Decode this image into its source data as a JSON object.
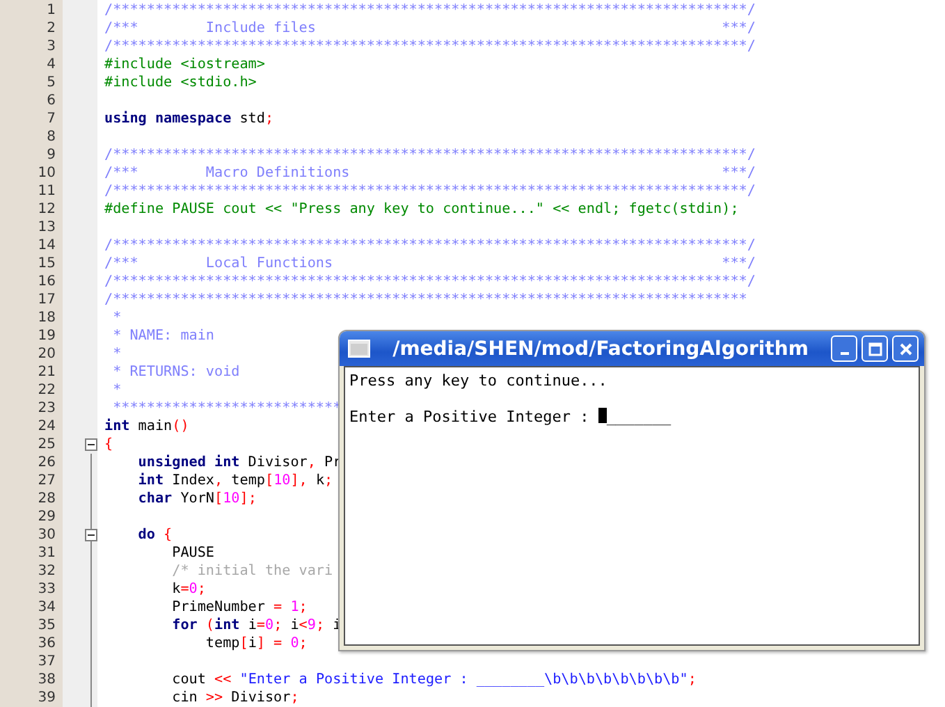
{
  "editor": {
    "lines": [
      {
        "number": "1",
        "tokens": [
          {
            "kind": "doc",
            "text": "/***************************************************************************/"
          }
        ]
      },
      {
        "number": "2",
        "tokens": [
          {
            "kind": "doc",
            "text": "/***        Include files                                                ***/"
          }
        ]
      },
      {
        "number": "3",
        "tokens": [
          {
            "kind": "doc",
            "text": "/***************************************************************************/"
          }
        ]
      },
      {
        "number": "4",
        "tokens": [
          {
            "kind": "preproc",
            "text": "#include <iostream>"
          }
        ]
      },
      {
        "number": "5",
        "tokens": [
          {
            "kind": "preproc",
            "text": "#include <stdio.h>"
          }
        ]
      },
      {
        "number": "6"
      },
      {
        "number": "7",
        "tokens": [
          {
            "kind": "keyword",
            "text": "using namespace"
          },
          {
            "kind": "plain",
            "text": " std"
          },
          {
            "kind": "operator",
            "text": ";"
          }
        ]
      },
      {
        "number": "8"
      },
      {
        "number": "9",
        "tokens": [
          {
            "kind": "doc",
            "text": "/***************************************************************************/"
          }
        ]
      },
      {
        "number": "10",
        "tokens": [
          {
            "kind": "doc",
            "text": "/***        Macro Definitions                                            ***/"
          }
        ]
      },
      {
        "number": "11",
        "tokens": [
          {
            "kind": "doc",
            "text": "/***************************************************************************/"
          }
        ]
      },
      {
        "number": "12",
        "tokens": [
          {
            "kind": "preproc",
            "text": "#define PAUSE cout << \"Press any key to continue...\" << endl; fgetc(stdin);"
          }
        ]
      },
      {
        "number": "13"
      },
      {
        "number": "14",
        "tokens": [
          {
            "kind": "doc",
            "text": "/***************************************************************************/"
          }
        ]
      },
      {
        "number": "15",
        "tokens": [
          {
            "kind": "doc",
            "text": "/***        Local Functions                                              ***/"
          }
        ]
      },
      {
        "number": "16",
        "tokens": [
          {
            "kind": "doc",
            "text": "/***************************************************************************/"
          }
        ]
      },
      {
        "number": "17",
        "tokens": [
          {
            "kind": "doc",
            "text": "/***************************************************************************"
          }
        ]
      },
      {
        "number": "18",
        "tokens": [
          {
            "kind": "doc",
            "text": " *"
          }
        ]
      },
      {
        "number": "19",
        "tokens": [
          {
            "kind": "doc",
            "text": " * NAME: main"
          }
        ]
      },
      {
        "number": "20",
        "tokens": [
          {
            "kind": "doc",
            "text": " *"
          }
        ]
      },
      {
        "number": "21",
        "tokens": [
          {
            "kind": "doc",
            "text": " * RETURNS: void"
          }
        ]
      },
      {
        "number": "22",
        "tokens": [
          {
            "kind": "doc",
            "text": " *"
          }
        ]
      },
      {
        "number": "23",
        "tokens": [
          {
            "kind": "doc",
            "text": " ***************************"
          }
        ]
      },
      {
        "number": "24",
        "tokens": [
          {
            "kind": "keyword",
            "text": "int"
          },
          {
            "kind": "plain",
            "text": " main"
          },
          {
            "kind": "operator",
            "text": "()"
          }
        ]
      },
      {
        "number": "25",
        "fold_expanded": true,
        "tokens": [
          {
            "kind": "operator",
            "text": "{"
          }
        ]
      },
      {
        "number": "26",
        "tokens": [
          {
            "kind": "keyword",
            "text": "    unsigned int"
          },
          {
            "kind": "plain",
            "text": " Divisor"
          },
          {
            "kind": "operator",
            "text": ","
          },
          {
            "kind": "plain",
            "text": " Pr"
          }
        ]
      },
      {
        "number": "27",
        "tokens": [
          {
            "kind": "keyword",
            "text": "    int"
          },
          {
            "kind": "plain",
            "text": " Index"
          },
          {
            "kind": "operator",
            "text": ","
          },
          {
            "kind": "plain",
            "text": " temp"
          },
          {
            "kind": "operator",
            "text": "["
          },
          {
            "kind": "number",
            "text": "10"
          },
          {
            "kind": "operator",
            "text": "],"
          },
          {
            "kind": "plain",
            "text": " k"
          },
          {
            "kind": "operator",
            "text": ";"
          }
        ]
      },
      {
        "number": "28",
        "tokens": [
          {
            "kind": "keyword",
            "text": "    char"
          },
          {
            "kind": "plain",
            "text": " YorN"
          },
          {
            "kind": "operator",
            "text": "["
          },
          {
            "kind": "number",
            "text": "10"
          },
          {
            "kind": "operator",
            "text": "];"
          }
        ]
      },
      {
        "number": "29"
      },
      {
        "number": "30",
        "fold_expanded": true,
        "tokens": [
          {
            "kind": "keyword",
            "text": "    do"
          },
          {
            "kind": "operator",
            "text": " {"
          }
        ]
      },
      {
        "number": "31",
        "tokens": [
          {
            "kind": "plain",
            "text": "        PAUSE"
          }
        ]
      },
      {
        "number": "32",
        "tokens": [
          {
            "kind": "comment",
            "text": "        /* initial the vari"
          }
        ]
      },
      {
        "number": "33",
        "tokens": [
          {
            "kind": "plain",
            "text": "        k"
          },
          {
            "kind": "operator",
            "text": "="
          },
          {
            "kind": "number",
            "text": "0"
          },
          {
            "kind": "operator",
            "text": ";"
          }
        ]
      },
      {
        "number": "34",
        "tokens": [
          {
            "kind": "plain",
            "text": "        PrimeNumber"
          },
          {
            "kind": "operator",
            "text": " ="
          },
          {
            "kind": "number",
            "text": " 1"
          },
          {
            "kind": "operator",
            "text": ";"
          }
        ]
      },
      {
        "number": "35",
        "tokens": [
          {
            "kind": "keyword",
            "text": "        for"
          },
          {
            "kind": "operator",
            "text": " ("
          },
          {
            "kind": "keyword",
            "text": "int"
          },
          {
            "kind": "plain",
            "text": " i"
          },
          {
            "kind": "operator",
            "text": "="
          },
          {
            "kind": "number",
            "text": "0"
          },
          {
            "kind": "operator",
            "text": ";"
          },
          {
            "kind": "plain",
            "text": " i"
          },
          {
            "kind": "operator",
            "text": "<"
          },
          {
            "kind": "number",
            "text": "9"
          },
          {
            "kind": "operator",
            "text": ";"
          },
          {
            "kind": "plain",
            "text": " i"
          }
        ]
      },
      {
        "number": "36",
        "tokens": [
          {
            "kind": "plain",
            "text": "            temp"
          },
          {
            "kind": "operator",
            "text": "["
          },
          {
            "kind": "plain",
            "text": "i"
          },
          {
            "kind": "operator",
            "text": "] ="
          },
          {
            "kind": "number",
            "text": " 0"
          },
          {
            "kind": "operator",
            "text": ";"
          }
        ]
      },
      {
        "number": "37"
      },
      {
        "number": "38",
        "tokens": [
          {
            "kind": "plain",
            "text": "        cout"
          },
          {
            "kind": "operator",
            "text": " <<"
          },
          {
            "kind": "string",
            "text": " \"Enter a Positive Integer : ________\\b\\b\\b\\b\\b\\b\\b\\b\""
          },
          {
            "kind": "operator",
            "text": ";"
          }
        ]
      },
      {
        "number": "39",
        "tokens": [
          {
            "kind": "plain",
            "text": "        cin"
          },
          {
            "kind": "operator",
            "text": " >>"
          },
          {
            "kind": "plain",
            "text": " Divisor"
          },
          {
            "kind": "operator",
            "text": ";"
          }
        ]
      }
    ]
  },
  "terminal": {
    "title": "/media/SHEN/mod/FactoringAlgorithm",
    "lines": [
      {
        "text": "Press any key to continue..."
      },
      {
        "text": "Enter a Positive Integer : ",
        "input": "_______",
        "cursor": true
      }
    ]
  }
}
